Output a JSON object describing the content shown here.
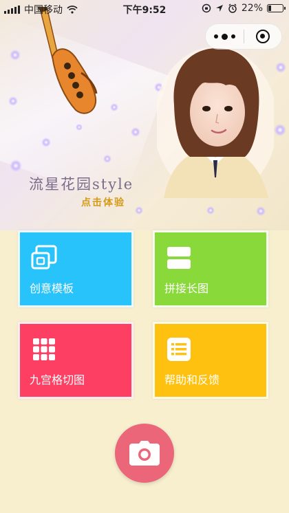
{
  "status_bar": {
    "carrier": "中国移动",
    "time": "下午9:52",
    "battery_percent": "22%",
    "battery_level": 0.22
  },
  "banner": {
    "title": "流星花园style",
    "subtitle": "点击体验"
  },
  "tiles": [
    {
      "label": "创意模板",
      "icon": "template-icon",
      "color": "#29c3fb"
    },
    {
      "label": "拼接长图",
      "icon": "stitch-icon",
      "color": "#8ad93a"
    },
    {
      "label": "九宫格切图",
      "icon": "grid-icon",
      "color": "#fd3f63"
    },
    {
      "label": "帮助和反馈",
      "icon": "list-icon",
      "color": "#fec10f"
    }
  ],
  "camera": {
    "icon": "camera-icon",
    "color": "#ec6679"
  }
}
